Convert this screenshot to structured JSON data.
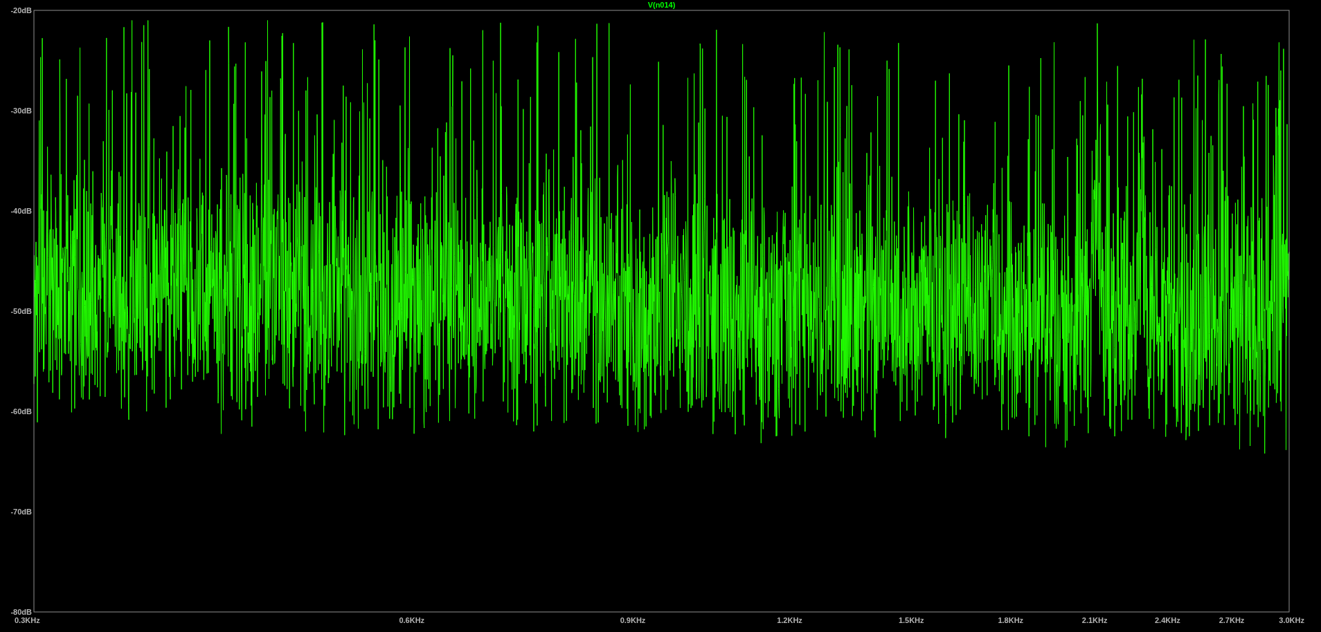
{
  "plot": {
    "trace_label": "V(n014)",
    "y_axis_labels": [
      "-20dB",
      "-30dB",
      "-40dB",
      "-50dB",
      "-60dB",
      "-70dB",
      "-80dB"
    ],
    "x_axis_labels": [
      "0.3KHz",
      "0.6KHz",
      "0.9KHz",
      "1.2KHz",
      "1.5KHz",
      "1.8KHz",
      "2.1KHz",
      "2.4KHz",
      "2.7KHz",
      "3.0KHz"
    ]
  }
}
